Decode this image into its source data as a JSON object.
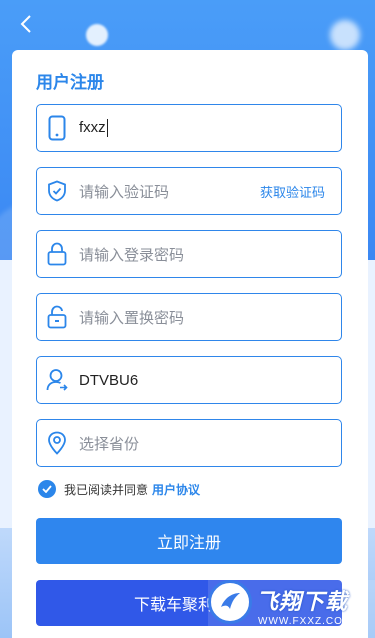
{
  "header": {
    "back_icon": "chevron-left-icon"
  },
  "form": {
    "title": "用户注册",
    "fields": [
      {
        "icon": "phone-icon",
        "value": "fxxz",
        "placeholder": ""
      },
      {
        "icon": "shield-icon",
        "value": "",
        "placeholder": "请输入验证码",
        "action": "获取验证码"
      },
      {
        "icon": "lock-icon",
        "value": "",
        "placeholder": "请输入登录密码"
      },
      {
        "icon": "unlock-icon",
        "value": "",
        "placeholder": "请输入置换密码"
      },
      {
        "icon": "user-invite-icon",
        "value": "DTVBU6",
        "placeholder": ""
      },
      {
        "icon": "location-pin-icon",
        "value": "",
        "placeholder": "选择省份"
      }
    ],
    "agreement": {
      "text": "我已阅读并同意",
      "link": "用户协议",
      "checked": true
    }
  },
  "buttons": {
    "register": "立即注册",
    "download": "下载车聚利"
  },
  "watermark": {
    "brand": "飞翔下载",
    "url": "WWW.FXXZ.COM"
  },
  "colors": {
    "accent": "#2b86ea",
    "background": "#3d8ef5",
    "download_button": "#3058e8"
  }
}
